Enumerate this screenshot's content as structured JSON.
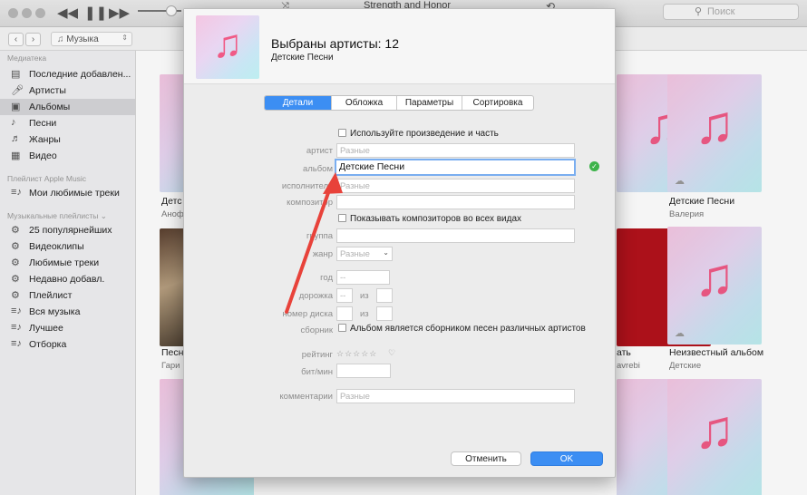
{
  "toolbar": {
    "now_playing": "Strength and Honor",
    "search_placeholder": "Поиск"
  },
  "navbar": {
    "media_label": "Музыка"
  },
  "sidebar": {
    "library_header": "Медиатека",
    "library_items": [
      {
        "label": "Последние добавлен...",
        "icon": "clock-icon"
      },
      {
        "label": "Артисты",
        "icon": "microphone-icon"
      },
      {
        "label": "Альбомы",
        "icon": "album-icon",
        "selected": true
      },
      {
        "label": "Песни",
        "icon": "note-icon"
      },
      {
        "label": "Жанры",
        "icon": "genres-icon"
      },
      {
        "label": "Видео",
        "icon": "film-icon"
      }
    ],
    "apple_music_header": "Плейлист Apple Music",
    "apple_music_items": [
      {
        "label": "Мои любимые треки",
        "icon": "playlist-icon"
      }
    ],
    "playlists_header": "Музыкальные плейлисты",
    "playlists": [
      {
        "label": "25 популярнейших",
        "icon": "gear-icon"
      },
      {
        "label": "Видеоклипы",
        "icon": "gear-icon"
      },
      {
        "label": "Любимые треки",
        "icon": "gear-icon"
      },
      {
        "label": "Недавно добавл.",
        "icon": "gear-icon"
      },
      {
        "label": "Плейлист",
        "icon": "gear-icon"
      },
      {
        "label": "Вся музыка",
        "icon": "playlist-icon"
      },
      {
        "label": "Лучшее",
        "icon": "playlist-icon"
      },
      {
        "label": "Отборка",
        "icon": "playlist-icon"
      }
    ]
  },
  "albums": {
    "partial_left": [
      {
        "title": "Детс",
        "artist": "Аноф"
      },
      {
        "title": "Песн",
        "artist": "Гари"
      }
    ],
    "partial_mid": [
      {
        "title": "ать",
        "artist": "avrebi"
      }
    ],
    "right": [
      {
        "title": "Детские Песни",
        "artist": "Валерия"
      },
      {
        "title": "Неизвестный альбом",
        "artist": "Детские"
      }
    ]
  },
  "dialog": {
    "title": "Выбраны артисты: 12",
    "subtitle": "Детские Песни",
    "tabs": [
      {
        "label": "Детали",
        "active": true
      },
      {
        "label": "Обложка",
        "active": false
      },
      {
        "label": "Параметры",
        "active": false
      },
      {
        "label": "Сортировка",
        "active": false
      }
    ],
    "use_artwork_label": "Используйте произведение и часть",
    "fields": {
      "artist_label": "артист",
      "artist_placeholder": "Разные",
      "album_label": "альбом",
      "album_value": "Детские Песни",
      "album_artist_label": "исполнитель",
      "album_artist_placeholder": "Разные",
      "composer_label": "композитор",
      "show_composers_label": "Показывать композиторов во всех видах",
      "grouping_label": "группа",
      "genre_label": "жанр",
      "genre_placeholder": "Разные",
      "year_label": "год",
      "year_placeholder": "--",
      "track_label": "дорожка",
      "track_placeholder": "--",
      "track_of": "из",
      "disc_label": "номер диска",
      "disc_of": "из",
      "compilation_label": "сборник",
      "compilation_text": "Альбом является сборником песен различных артистов",
      "rating_label": "рейтинг",
      "rating_stars": "☆☆☆☆☆",
      "bpm_label": "бит/мин",
      "comments_label": "комментарии",
      "comments_placeholder": "Разные"
    },
    "cancel_label": "Отменить",
    "ok_label": "OK"
  },
  "colors": {
    "accent": "#3c8ef3",
    "annotation_arrow": "#e8423a",
    "note": "#f05a86",
    "valid": "#3db34a"
  }
}
